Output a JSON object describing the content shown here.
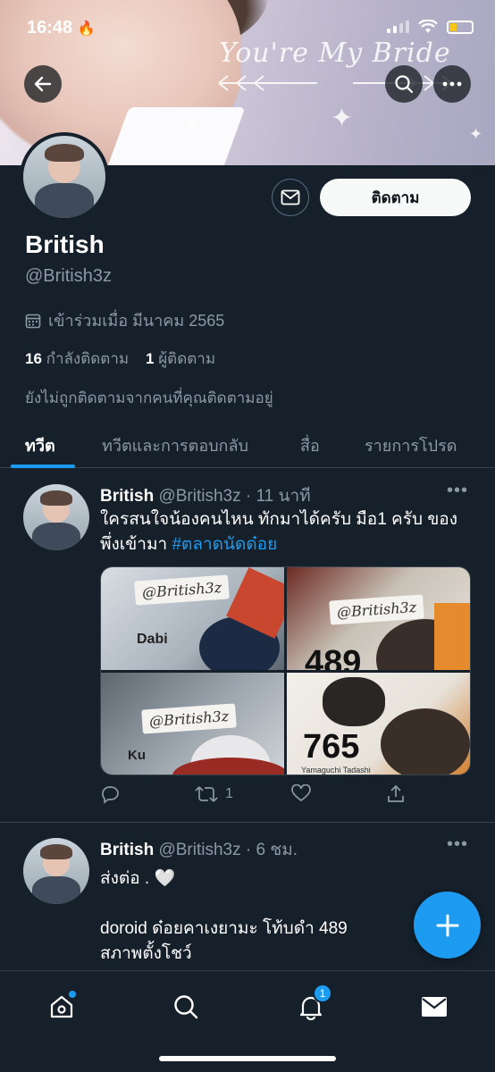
{
  "status_bar": {
    "time": "16:48"
  },
  "banner": {
    "text": "You're My Bride"
  },
  "profile": {
    "name": "British",
    "handle": "@British3z",
    "joined": "เข้าร่วมเมื่อ มีนาคม 2565",
    "following_count": "16",
    "following_label": "กำลังติดตาม",
    "followers_count": "1",
    "followers_label": "ผู้ติดตาม",
    "not_followed_notice": "ยังไม่ถูกติดตามจากคนที่คุณติดตามอยู่",
    "follow_button": "ติดตาม"
  },
  "tabs": [
    {
      "label": "ทวีต"
    },
    {
      "label": "ทวีตและการตอบกลับ"
    },
    {
      "label": "สื่อ"
    },
    {
      "label": "รายการโปรด"
    }
  ],
  "tweets": [
    {
      "name": "British",
      "handle": "@British3z",
      "time": "· 11 นาที",
      "text": "ใครสนใจน้องคนไหน ทักมาได้ครับ มือ1 ครับ ของพึ่งเข้ามา",
      "hashtag": "#ตลาดนัดด๋อย",
      "media": {
        "note1": "@British3z",
        "label_dabi": "Dabi",
        "note2": "@British3z",
        "num_489": "489",
        "note3": "@British3z",
        "label_ku": "Ku",
        "num_765": "765",
        "label_yamaguchi": "Yamaguchi Tadashi"
      },
      "retweets": "1"
    },
    {
      "name": "British",
      "handle": "@British3z",
      "time": "· 6 ชม.",
      "line1": "ส่งต่อ . 🤍",
      "line2": "doroid ด๋อยคาเงยามะ โท้บดำ 489",
      "line3": "สภาพตั้งโชว์"
    }
  ],
  "nav": {
    "notifications_badge": "1"
  },
  "colors": {
    "accent": "#1d9bf0",
    "background": "#15202b",
    "muted": "#8b98a5"
  }
}
